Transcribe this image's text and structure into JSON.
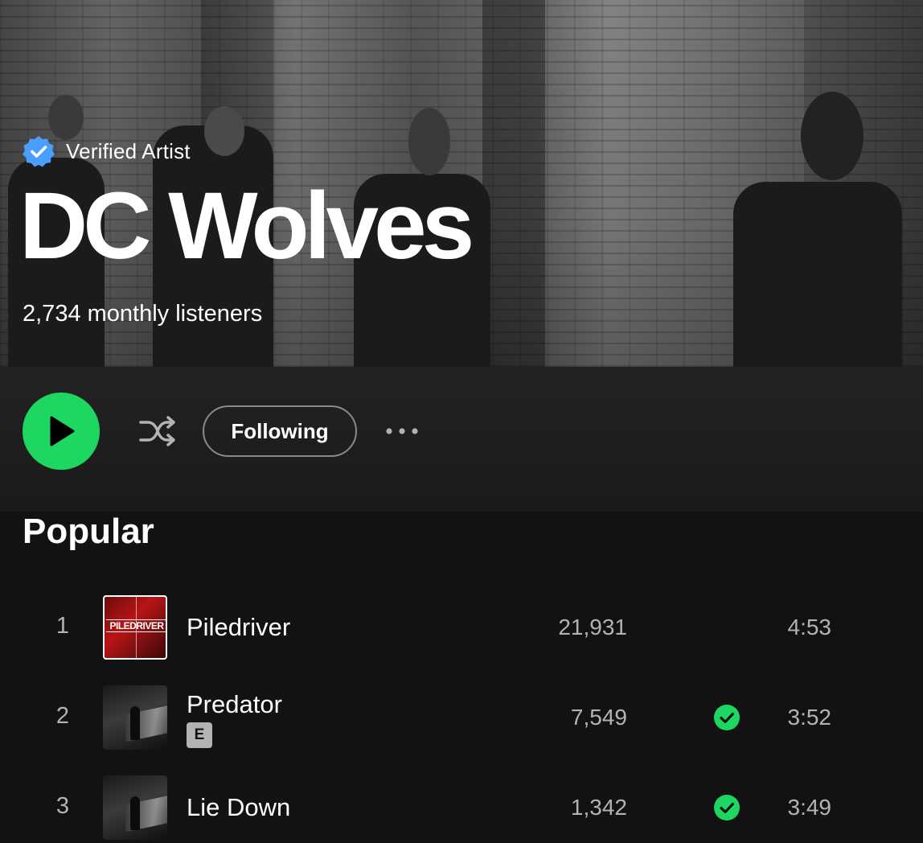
{
  "header": {
    "verified_label": "Verified Artist",
    "artist_name": "DC Wolves",
    "monthly_listeners": "2,734 monthly listeners"
  },
  "actions": {
    "play_icon": "play-icon",
    "shuffle_icon": "shuffle-icon",
    "following_label": "Following",
    "more_icon": "more-horizontal-icon"
  },
  "popular": {
    "title": "Popular",
    "tracks": [
      {
        "number": "1",
        "title": "Piledriver",
        "explicit": false,
        "plays": "21,931",
        "saved": false,
        "duration": "4:53",
        "cover_text": "PILEDRIVER"
      },
      {
        "number": "2",
        "title": "Predator",
        "explicit": true,
        "explicit_label": "E",
        "plays": "7,549",
        "saved": true,
        "duration": "3:52"
      },
      {
        "number": "3",
        "title": "Lie Down",
        "explicit": false,
        "plays": "1,342",
        "saved": true,
        "duration": "3:49"
      }
    ]
  },
  "colors": {
    "accent": "#1ed760",
    "verified_badge": "#4a9eff",
    "background": "#121212",
    "secondary_text": "#b3b3b3"
  }
}
